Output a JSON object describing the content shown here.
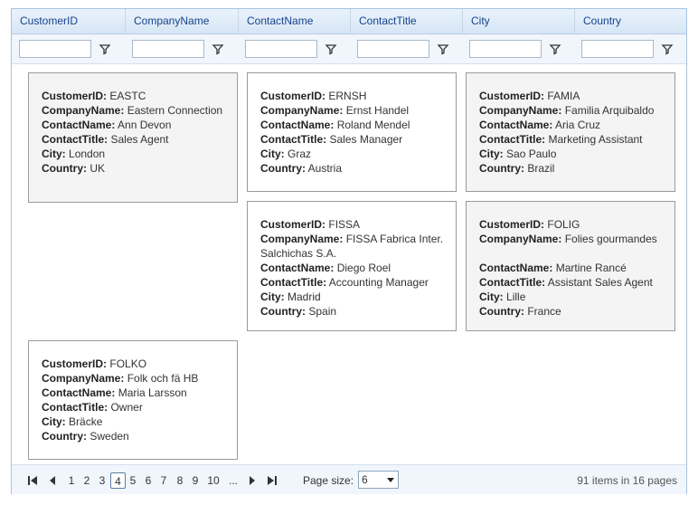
{
  "columns": [
    "CustomerID",
    "CompanyName",
    "ContactName",
    "ContactTitle",
    "City",
    "Country"
  ],
  "cards": [
    {
      "id": "EASTC",
      "company": "Eastern Connection",
      "contact": "Ann Devon",
      "title": "Sales Agent",
      "city": "London",
      "country": "UK"
    },
    {
      "id": "ERNSH",
      "company": "Ernst Handel",
      "contact": "Roland Mendel",
      "title": "Sales Manager",
      "city": "Graz",
      "country": "Austria"
    },
    {
      "id": "FAMIA",
      "company": "Familia Arquibaldo",
      "contact": "Aria Cruz",
      "title": "Marketing Assistant",
      "city": "Sao Paulo",
      "country": "Brazil"
    },
    {
      "id": "FISSA",
      "company": "FISSA Fabrica Inter. Salchichas S.A.",
      "contact": "Diego Roel",
      "title": "Accounting Manager",
      "city": "Madrid",
      "country": "Spain"
    },
    {
      "id": "FOLIG",
      "company": "Folies gourmandes",
      "contact": "Martine Rancé",
      "title": "Assistant Sales Agent",
      "city": "Lille",
      "country": "France"
    },
    {
      "id": "FOLKO",
      "company": "Folk och fä HB",
      "contact": "Maria Larsson",
      "title": "Owner",
      "city": "Bräcke",
      "country": "Sweden"
    }
  ],
  "field_labels": {
    "id": "CustomerID:",
    "company": "CompanyName:",
    "contact": "ContactName:",
    "title": "ContactTitle:",
    "city": "City:",
    "country": "Country:"
  },
  "pager": {
    "pages": [
      "1",
      "2",
      "3",
      "4",
      "5",
      "6",
      "7",
      "8",
      "9",
      "10",
      "..."
    ],
    "current": "4",
    "page_size_label": "Page size:",
    "page_size": "6",
    "info_prefix": "91",
    "info_mid": " items in ",
    "info_pages": "16",
    "info_suffix": " pages"
  },
  "icons": {
    "filter": "filter-icon",
    "first": "first-page-icon",
    "prev": "prev-page-icon",
    "next": "next-page-icon",
    "last": "last-page-icon"
  }
}
